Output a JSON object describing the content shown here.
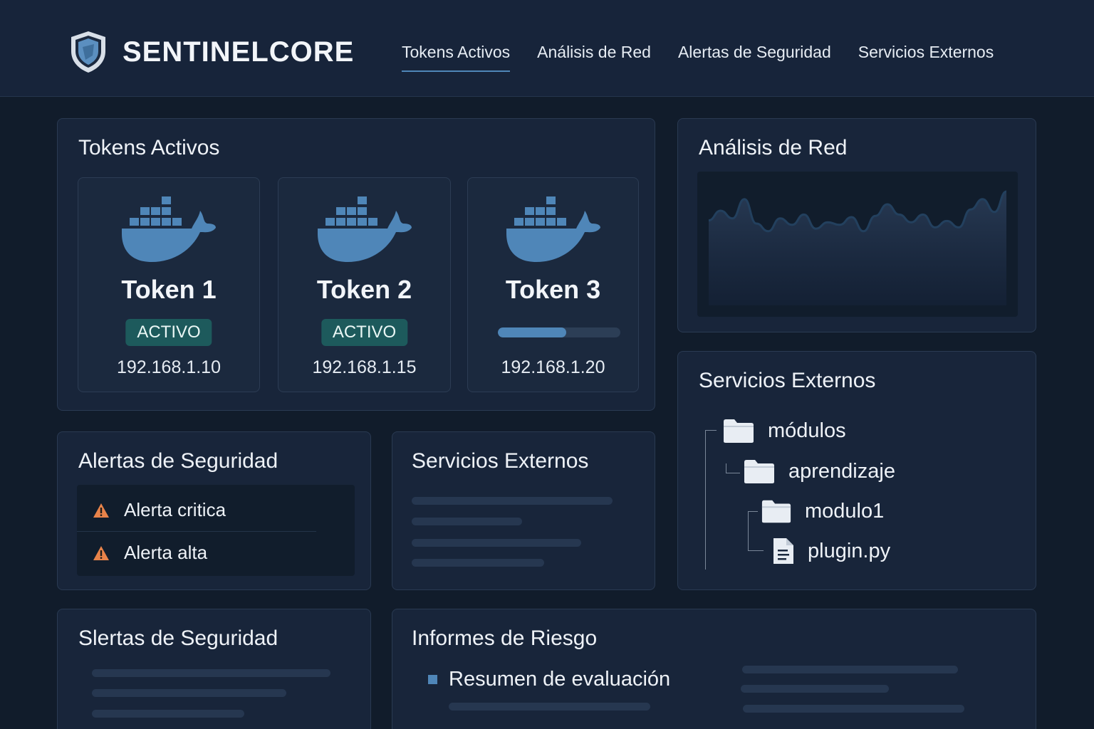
{
  "header": {
    "brand": "SENTINELCORE",
    "nav": [
      {
        "label": "Tokens  Activos",
        "active": true
      },
      {
        "label": "Análisis de Red",
        "active": false
      },
      {
        "label": "Alertas de Seguridad",
        "active": false
      },
      {
        "label": "Servicios Externos",
        "active": false
      }
    ]
  },
  "tokens": {
    "title": "Tokens Activos",
    "items": [
      {
        "name": "Token 1",
        "status": "ACTIVO",
        "ip": "192.168.1.10"
      },
      {
        "name": "Token 2",
        "status": "ACTIVO",
        "ip": "192.168.1.15"
      },
      {
        "name": "Token 3",
        "progress": 0.56,
        "ip": "192.168.1.20"
      }
    ]
  },
  "network": {
    "title": "Análisis de Red",
    "series": [
      0.45,
      0.3,
      0.42,
      0.12,
      0.5,
      0.62,
      0.42,
      0.52,
      0.36,
      0.58,
      0.48,
      0.52,
      0.4,
      0.62,
      0.38,
      0.2,
      0.36,
      0.48,
      0.36,
      0.56,
      0.46,
      0.56,
      0.28,
      0.12,
      0.32,
      0.0
    ]
  },
  "alerts": {
    "title": "Alertas de Seguridad",
    "items": [
      {
        "label": "Alerta critica"
      },
      {
        "label": "Alerta alta"
      }
    ]
  },
  "services_small": {
    "title": "Servicios Externos"
  },
  "services_tree": {
    "title": "Servicios Externos",
    "items": [
      {
        "label": "módulos",
        "kind": "folder"
      },
      {
        "label": "aprendizaje",
        "kind": "folder"
      },
      {
        "label": "modulo1",
        "kind": "folder"
      },
      {
        "label": "plugin.py",
        "kind": "file"
      }
    ]
  },
  "alerts2": {
    "title": "Slertas de Seguridad"
  },
  "reports": {
    "title": "Informes de Riesgo",
    "item": "Resumen de evaluación"
  },
  "colors": {
    "accent": "#4f86b8",
    "badge": "#1d5a5c",
    "warning": "#e8834a",
    "background": "#111c2b",
    "card": "#18253a"
  }
}
